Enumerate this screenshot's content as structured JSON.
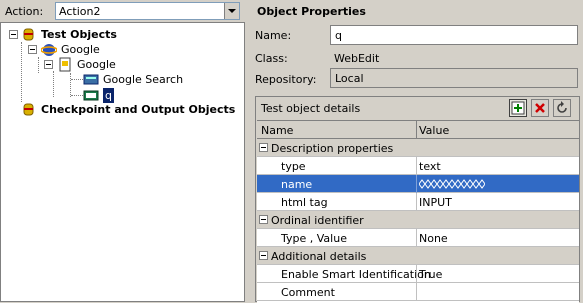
{
  "action": {
    "label": "Action:",
    "value": "Action2"
  },
  "tree": {
    "root": "Test Objects",
    "browser": "Google",
    "page": "Google",
    "items": [
      "Google Search",
      "q"
    ],
    "checkpoints": "Checkpoint and Output Objects"
  },
  "properties": {
    "title": "Object Properties",
    "name_label": "Name:",
    "name_value": "q",
    "class_label": "Class:",
    "class_value": "WebEdit",
    "repository_label": "Repository:",
    "repository_value": "Local"
  },
  "details": {
    "title": "Test object details",
    "columns": [
      "Name",
      "Value"
    ],
    "rows": [
      {
        "kind": "category",
        "name": "Description properties"
      },
      {
        "kind": "prop",
        "name": "type",
        "value": "text"
      },
      {
        "kind": "prop",
        "name": "name",
        "value": "",
        "selected": true,
        "masked": true
      },
      {
        "kind": "prop",
        "name": "html tag",
        "value": "INPUT"
      },
      {
        "kind": "category",
        "name": "Ordinal identifier"
      },
      {
        "kind": "prop",
        "name": "Type , Value",
        "value": "None"
      },
      {
        "kind": "category",
        "name": "Additional details"
      },
      {
        "kind": "prop",
        "name": "Enable Smart Identification",
        "value": "True"
      },
      {
        "kind": "prop",
        "name": "Comment",
        "value": ""
      }
    ]
  },
  "icons": {
    "toolbar": [
      "add-icon",
      "delete-icon",
      "refresh-icon"
    ]
  }
}
